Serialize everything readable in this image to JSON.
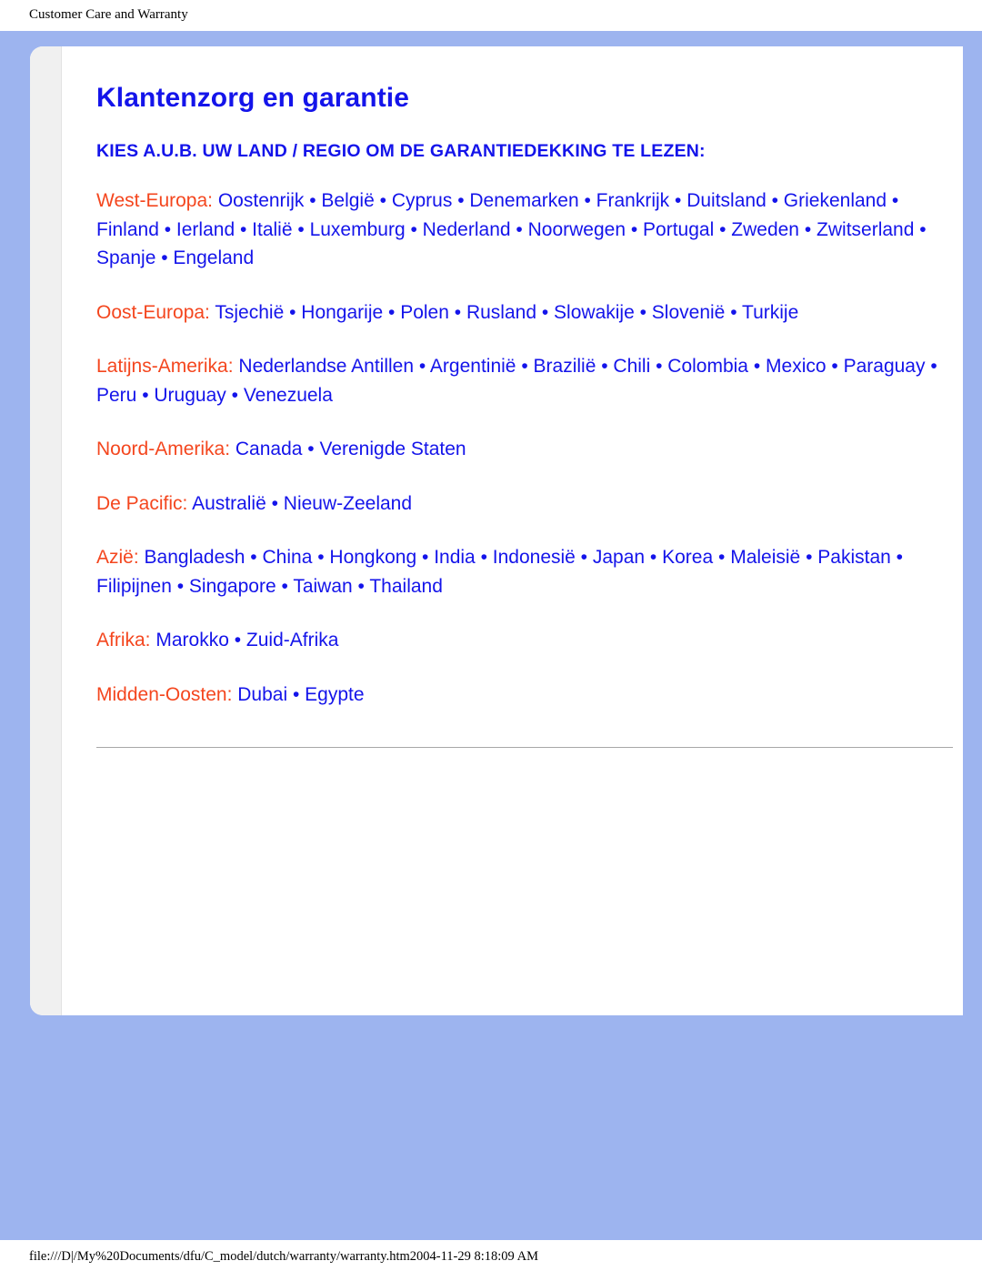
{
  "print": {
    "header": "Customer Care and Warranty",
    "footer": "file:///D|/My%20Documents/dfu/C_model/dutch/warranty/warranty.htm2004-11-29 8:18:09 AM"
  },
  "colors": {
    "frame_blue": "#9db4ef",
    "link_blue": "#1414ea",
    "label_orange": "#f4461e",
    "gutter_grey": "#f0f0f0",
    "rule_grey": "#a8a8a8"
  },
  "document": {
    "title": "Klantenzorg en garantie",
    "subtitle": "KIES A.U.B. UW LAND / REGIO OM DE GARANTIEDEKKING TE LEZEN:",
    "separator": " • ",
    "regions": [
      {
        "label": "West-Europa:",
        "countries": [
          "Oostenrijk",
          "België",
          "Cyprus",
          "Denemarken",
          "Frankrijk",
          "Duitsland",
          "Griekenland",
          "Finland",
          "Ierland",
          "Italië",
          "Luxemburg",
          "Nederland",
          "Noorwegen",
          "Portugal",
          "Zweden",
          "Zwitserland",
          "Spanje",
          "Engeland"
        ]
      },
      {
        "label": "Oost-Europa:",
        "countries": [
          "Tsjechië",
          "Hongarije",
          "Polen",
          "Rusland",
          "Slowakije",
          "Slovenië",
          "Turkije"
        ]
      },
      {
        "label": "Latijns-Amerika:",
        "countries": [
          "Nederlandse Antillen",
          "Argentinië",
          "Brazilië",
          "Chili",
          "Colombia",
          "Mexico",
          "Paraguay",
          "Peru",
          "Uruguay",
          "Venezuela"
        ]
      },
      {
        "label": "Noord-Amerika:",
        "countries": [
          "Canada",
          "Verenigde Staten"
        ]
      },
      {
        "label": "De Pacific:",
        "countries": [
          "Australië",
          "Nieuw-Zeeland"
        ]
      },
      {
        "label": "Azië:",
        "countries": [
          "Bangladesh",
          "China",
          "Hongkong",
          "India",
          "Indonesië",
          "Japan",
          "Korea",
          "Maleisië",
          "Pakistan",
          "Filipijnen",
          "Singapore",
          "Taiwan",
          "Thailand"
        ]
      },
      {
        "label": "Afrika:",
        "countries": [
          "Marokko",
          "Zuid-Afrika"
        ]
      },
      {
        "label": "Midden-Oosten:",
        "countries": [
          "Dubai",
          "Egypte"
        ]
      }
    ]
  }
}
